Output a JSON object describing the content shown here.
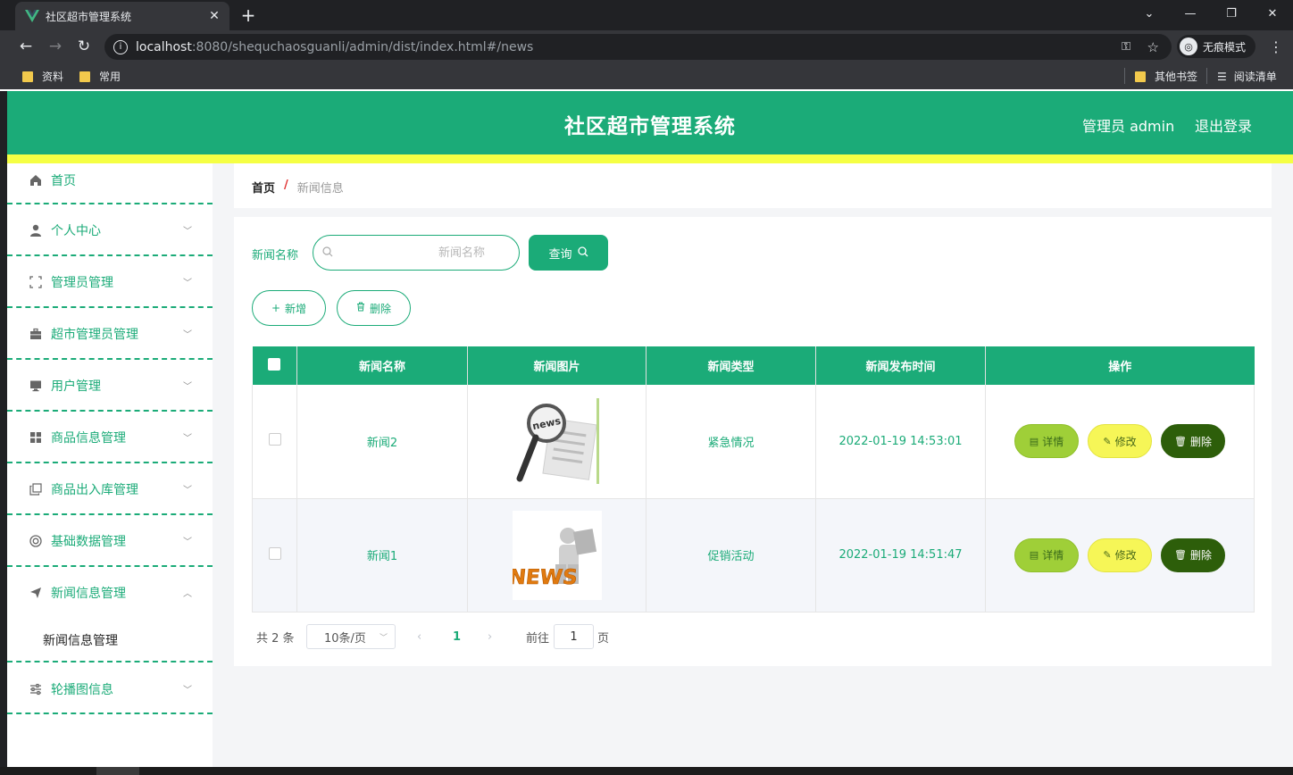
{
  "browser": {
    "tab_title": "社区超市管理系统",
    "url_host": "localhost",
    "url_rest": ":8080/shequchaosguanli/admin/dist/index.html#/news",
    "incognito_label": "无痕模式",
    "bookmarks": [
      "资料",
      "常用"
    ],
    "bookmarks_right": [
      "其他书签",
      "阅读清单"
    ]
  },
  "header": {
    "title": "社区超市管理系统",
    "user": "管理员 admin",
    "logout": "退出登录"
  },
  "sidebar": {
    "items": [
      {
        "label": "首页",
        "icon": "home-icon"
      },
      {
        "label": "个人中心",
        "icon": "user-icon"
      },
      {
        "label": "管理员管理",
        "icon": "fullscreen-icon"
      },
      {
        "label": "超市管理员管理",
        "icon": "briefcase-icon"
      },
      {
        "label": "用户管理",
        "icon": "monitor-icon"
      },
      {
        "label": "商品信息管理",
        "icon": "grid-icon"
      },
      {
        "label": "商品出入库管理",
        "icon": "copy-icon"
      },
      {
        "label": "基础数据管理",
        "icon": "lifebuoy-icon"
      },
      {
        "label": "新闻信息管理",
        "icon": "send-icon"
      },
      {
        "label": "轮播图信息",
        "icon": "sliders-icon"
      }
    ],
    "sub_item": "新闻信息管理"
  },
  "breadcrumb": {
    "home": "首页",
    "separator": "/",
    "current": "新闻信息"
  },
  "search": {
    "label": "新闻名称",
    "placeholder": "新闻名称",
    "query_button": "查询"
  },
  "actions": {
    "add": "新增",
    "delete": "删除"
  },
  "table": {
    "headers": [
      "新闻名称",
      "新闻图片",
      "新闻类型",
      "新闻发布时间",
      "操作"
    ],
    "rows": [
      {
        "name": "新闻2",
        "type": "紧急情况",
        "time": "2022-01-19 14:53:01"
      },
      {
        "name": "新闻1",
        "type": "促销活动",
        "time": "2022-01-19 14:51:47"
      }
    ],
    "row_actions": {
      "detail": "详情",
      "edit": "修改",
      "delete": "删除"
    }
  },
  "pager": {
    "total": "共 2 条",
    "page_size": "10条/页",
    "current_page": "1",
    "goto_label": "前往",
    "goto_value": "1",
    "page_suffix": "页"
  },
  "colors": {
    "primary": "#1bab78",
    "accent_bar": "#f5ff44",
    "detail_btn": "#9fcf38",
    "edit_btn": "#f6f657",
    "delete_btn": "#2d5e0a"
  }
}
